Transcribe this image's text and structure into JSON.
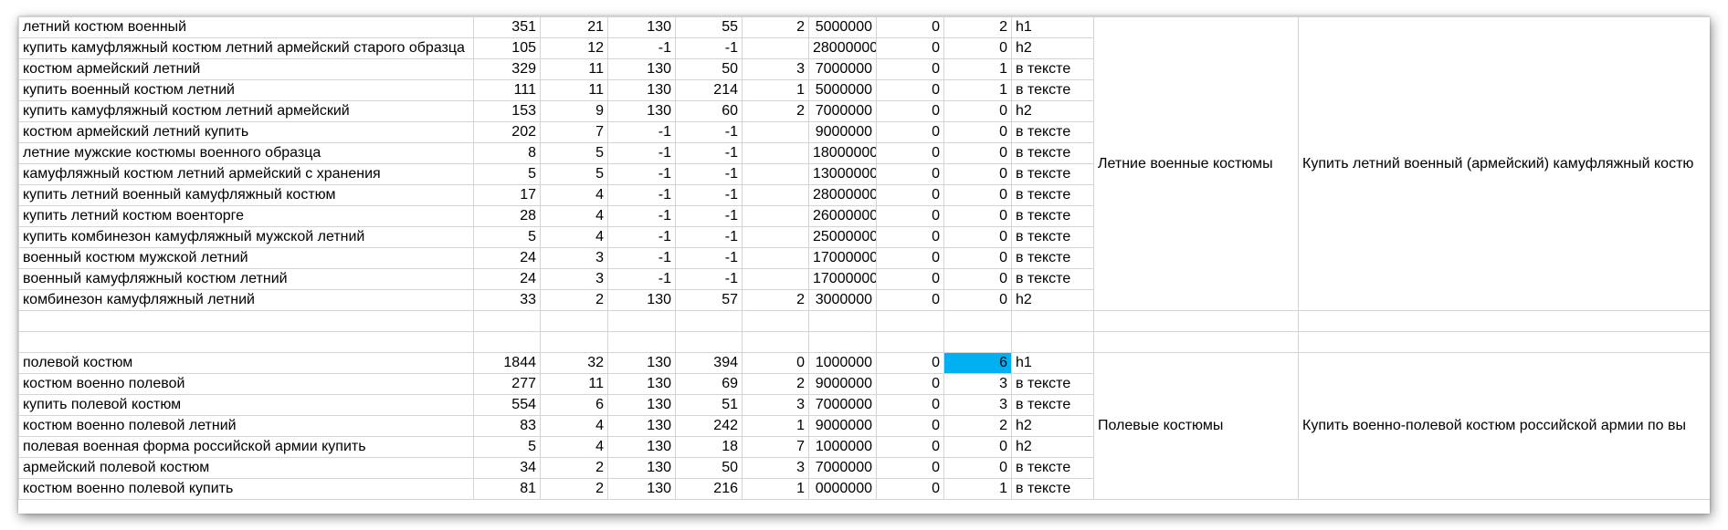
{
  "sheet": {
    "highlight_color": "#00b0f0",
    "groups": [
      {
        "category": "Летние военные костюмы",
        "description": "Купить летний военный (армейский) камуфляжный костю",
        "rows": [
          {
            "kw": "летний костюм военный",
            "c1": "351",
            "c2": "21",
            "c3": "130",
            "c4": "55",
            "c5": "2",
            "c6": "5000000",
            "c7": "0",
            "c8": "2",
            "tag": "h1"
          },
          {
            "kw": "купить камуфляжный костюм летний армейский старого образца",
            "c1": "105",
            "c2": "12",
            "c3": "-1",
            "c4": "-1",
            "c5": "",
            "c6": "28000000",
            "c7": "0",
            "c8": "0",
            "tag": "h2"
          },
          {
            "kw": "костюм армейский летний",
            "c1": "329",
            "c2": "11",
            "c3": "130",
            "c4": "50",
            "c5": "3",
            "c6": "7000000",
            "c7": "0",
            "c8": "1",
            "tag": "в тексте"
          },
          {
            "kw": "купить военный костюм летний",
            "c1": "111",
            "c2": "11",
            "c3": "130",
            "c4": "214",
            "c5": "1",
            "c6": "5000000",
            "c7": "0",
            "c8": "1",
            "tag": "в тексте"
          },
          {
            "kw": "купить камуфляжный костюм летний армейский",
            "c1": "153",
            "c2": "9",
            "c3": "130",
            "c4": "60",
            "c5": "2",
            "c6": "7000000",
            "c7": "0",
            "c8": "0",
            "tag": "h2"
          },
          {
            "kw": "костюм армейский летний купить",
            "c1": "202",
            "c2": "7",
            "c3": "-1",
            "c4": "-1",
            "c5": "",
            "c6": "9000000",
            "c7": "0",
            "c8": "0",
            "tag": "в тексте"
          },
          {
            "kw": "летние мужские костюмы военного образца",
            "c1": "8",
            "c2": "5",
            "c3": "-1",
            "c4": "-1",
            "c5": "",
            "c6": "18000000",
            "c7": "0",
            "c8": "0",
            "tag": "в тексте"
          },
          {
            "kw": "камуфляжный костюм летний армейский с хранения",
            "c1": "5",
            "c2": "5",
            "c3": "-1",
            "c4": "-1",
            "c5": "",
            "c6": "13000000",
            "c7": "0",
            "c8": "0",
            "tag": "в тексте"
          },
          {
            "kw": "купить летний военный камуфляжный костюм",
            "c1": "17",
            "c2": "4",
            "c3": "-1",
            "c4": "-1",
            "c5": "",
            "c6": "28000000",
            "c7": "0",
            "c8": "0",
            "tag": "в тексте"
          },
          {
            "kw": "купить летний костюм военторге",
            "c1": "28",
            "c2": "4",
            "c3": "-1",
            "c4": "-1",
            "c5": "",
            "c6": "26000000",
            "c7": "0",
            "c8": "0",
            "tag": "в тексте"
          },
          {
            "kw": "купить комбинезон камуфляжный мужской летний",
            "c1": "5",
            "c2": "4",
            "c3": "-1",
            "c4": "-1",
            "c5": "",
            "c6": "25000000",
            "c7": "0",
            "c8": "0",
            "tag": "в тексте"
          },
          {
            "kw": "военный костюм мужской летний",
            "c1": "24",
            "c2": "3",
            "c3": "-1",
            "c4": "-1",
            "c5": "",
            "c6": "17000000",
            "c7": "0",
            "c8": "0",
            "tag": "в тексте"
          },
          {
            "kw": "военный камуфляжный костюм летний",
            "c1": "24",
            "c2": "3",
            "c3": "-1",
            "c4": "-1",
            "c5": "",
            "c6": "17000000",
            "c7": "0",
            "c8": "0",
            "tag": "в тексте"
          },
          {
            "kw": "комбинезон камуфляжный летний",
            "c1": "33",
            "c2": "2",
            "c3": "130",
            "c4": "57",
            "c5": "2",
            "c6": "3000000",
            "c7": "0",
            "c8": "0",
            "tag": "h2"
          }
        ]
      },
      {
        "category": "Полевые костюмы",
        "description": "Купить военно-полевой костюм российской армии по вы",
        "rows": [
          {
            "kw": "полевой костюм",
            "c1": "1844",
            "c2": "32",
            "c3": "130",
            "c4": "394",
            "c5": "0",
            "c6": "1000000",
            "c7": "0",
            "c8": "6",
            "tag": "h1",
            "hl": true
          },
          {
            "kw": "костюм военно полевой",
            "c1": "277",
            "c2": "11",
            "c3": "130",
            "c4": "69",
            "c5": "2",
            "c6": "9000000",
            "c7": "0",
            "c8": "3",
            "tag": "в тексте"
          },
          {
            "kw": "купить полевой костюм",
            "c1": "554",
            "c2": "6",
            "c3": "130",
            "c4": "51",
            "c5": "3",
            "c6": "7000000",
            "c7": "0",
            "c8": "3",
            "tag": "в тексте"
          },
          {
            "kw": "костюм военно полевой летний",
            "c1": "83",
            "c2": "4",
            "c3": "130",
            "c4": "242",
            "c5": "1",
            "c6": "9000000",
            "c7": "0",
            "c8": "2",
            "tag": "h2"
          },
          {
            "kw": "полевая военная форма российской армии купить",
            "c1": "5",
            "c2": "4",
            "c3": "130",
            "c4": "18",
            "c5": "7",
            "c6": "1000000",
            "c7": "0",
            "c8": "0",
            "tag": "h2"
          },
          {
            "kw": "армейский полевой костюм",
            "c1": "34",
            "c2": "2",
            "c3": "130",
            "c4": "50",
            "c5": "3",
            "c6": "7000000",
            "c7": "0",
            "c8": "0",
            "tag": "в тексте"
          },
          {
            "kw": "костюм военно полевой купить",
            "c1": "81",
            "c2": "2",
            "c3": "130",
            "c4": "216",
            "c5": "1",
            "c6": "0000000",
            "c7": "0",
            "c8": "1",
            "tag": "в тексте"
          }
        ]
      }
    ]
  }
}
